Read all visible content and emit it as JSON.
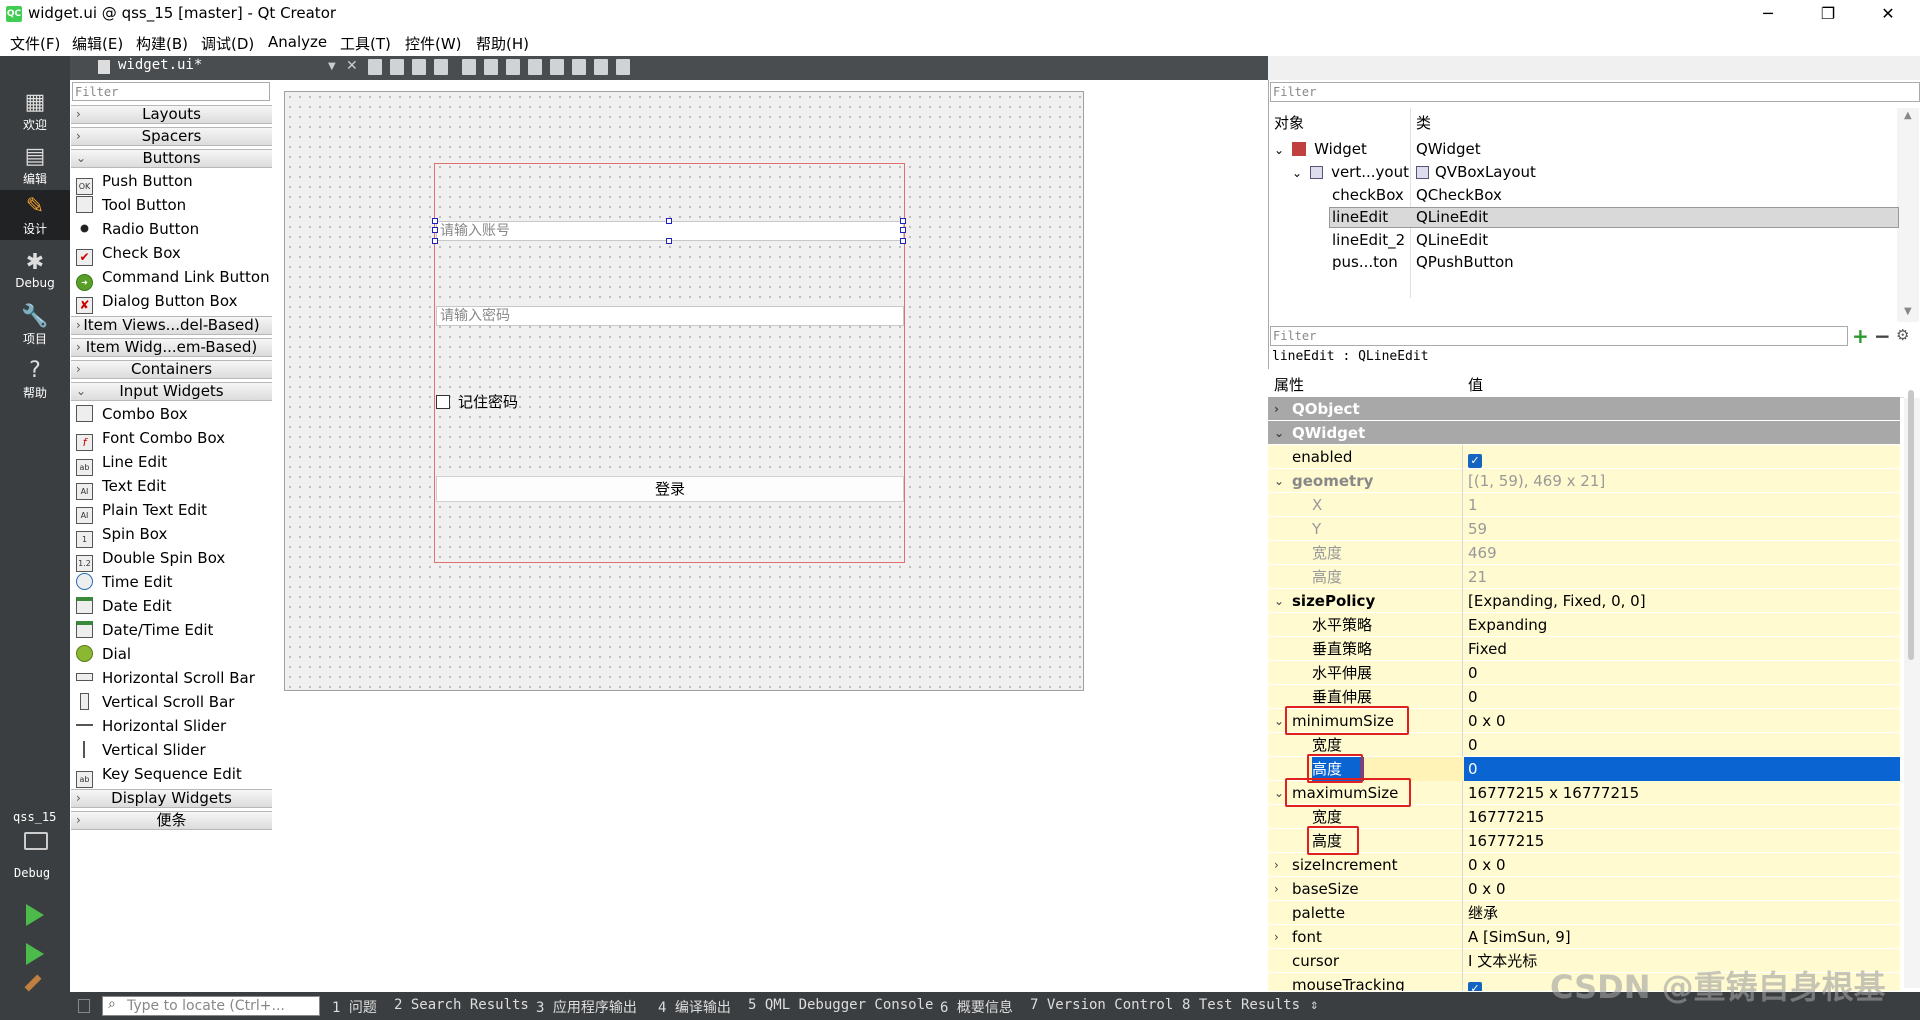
{
  "window": {
    "title": "widget.ui @ qss_15 [master] - Qt Creator",
    "app_icon_text": "QC",
    "minimize": "─",
    "restore": "❐",
    "close": "✕"
  },
  "menu": [
    "文件(F)",
    "编辑(E)",
    "构建(B)",
    "调试(D)",
    "Analyze",
    "工具(T)",
    "控件(W)",
    "帮助(H)"
  ],
  "modes": [
    {
      "label": "欢迎",
      "icon": "grid-icon",
      "glyph": "▦"
    },
    {
      "label": "编辑",
      "icon": "document-icon",
      "glyph": "▤"
    },
    {
      "label": "设计",
      "icon": "pencil-icon",
      "glyph": "✎"
    },
    {
      "label": "Debug",
      "icon": "bug-icon",
      "glyph": "✱"
    },
    {
      "label": "项目",
      "icon": "wrench-icon",
      "glyph": "🔧"
    },
    {
      "label": "帮助",
      "icon": "help-icon",
      "glyph": "?"
    }
  ],
  "kit": {
    "project": "qss_15",
    "config": "Debug"
  },
  "editor": {
    "file_tab": "widget.ui*",
    "close": "✕"
  },
  "widget_box": {
    "filter_placeholder": "Filter",
    "categories": {
      "layouts": "Layouts",
      "spacers": "Spacers",
      "buttons": "Buttons",
      "item_views": "Item Views...del-Based)",
      "item_widgets": "Item Widg...em-Based)",
      "containers": "Containers",
      "input_widgets": "Input Widgets",
      "display_widgets": "Display Widgets",
      "scratchpad": "便条"
    },
    "buttons": [
      "Push Button",
      "Tool Button",
      "Radio Button",
      "Check Box",
      "Command Link Button",
      "Dialog Button Box"
    ],
    "inputs": [
      "Combo Box",
      "Font Combo Box",
      "Line Edit",
      "Text Edit",
      "Plain Text Edit",
      "Spin Box",
      "Double Spin Box",
      "Time Edit",
      "Date Edit",
      "Date/Time Edit",
      "Dial",
      "Horizontal Scroll Bar",
      "Vertical Scroll Bar",
      "Horizontal Slider",
      "Vertical Slider",
      "Key Sequence Edit"
    ]
  },
  "form": {
    "account_placeholder": "请输入账号",
    "password_placeholder": "请输入密码",
    "remember_label": "记住密码",
    "login_label": "登录"
  },
  "object_inspector": {
    "filter_placeholder": "Filter",
    "col_object": "对象",
    "col_class": "类",
    "rows": [
      {
        "name": "Widget",
        "cls": "QWidget"
      },
      {
        "name": "vert...yout",
        "cls": "QVBoxLayout"
      },
      {
        "name": "checkBox",
        "cls": "QCheckBox"
      },
      {
        "name": "lineEdit",
        "cls": "QLineEdit"
      },
      {
        "name": "lineEdit_2",
        "cls": "QLineEdit"
      },
      {
        "name": "pus...ton",
        "cls": "QPushButton"
      }
    ]
  },
  "property_editor": {
    "filter_placeholder": "Filter",
    "title": "lineEdit : QLineEdit",
    "col_property": "属性",
    "col_value": "值",
    "rows": [
      {
        "name": "QObject",
        "value": ""
      },
      {
        "name": "QWidget",
        "value": ""
      },
      {
        "name": "enabled",
        "value": "✓"
      },
      {
        "name": "geometry",
        "value": "[(1, 59), 469 x 21]"
      },
      {
        "name": "X",
        "value": "1"
      },
      {
        "name": "Y",
        "value": "59"
      },
      {
        "name": "宽度",
        "value": "469"
      },
      {
        "name": "高度",
        "value": "21"
      },
      {
        "name": "sizePolicy",
        "value": "[Expanding, Fixed, 0, 0]"
      },
      {
        "name": "水平策略",
        "value": "Expanding"
      },
      {
        "name": "垂直策略",
        "value": "Fixed"
      },
      {
        "name": "水平伸展",
        "value": "0"
      },
      {
        "name": "垂直伸展",
        "value": "0"
      },
      {
        "name": "minimumSize",
        "value": "0 x 0"
      },
      {
        "name": "宽度",
        "value": "0"
      },
      {
        "name": "高度",
        "value": "0"
      },
      {
        "name": "maximumSize",
        "value": "16777215 x 16777215"
      },
      {
        "name": "宽度",
        "value": "16777215"
      },
      {
        "name": "高度",
        "value": "16777215"
      },
      {
        "name": "sizeIncrement",
        "value": "0 x 0"
      },
      {
        "name": "baseSize",
        "value": "0 x 0"
      },
      {
        "name": "palette",
        "value": "继承"
      },
      {
        "name": "font",
        "value": "A  [SimSun, 9]"
      },
      {
        "name": "cursor",
        "value": "I  文本光标"
      },
      {
        "name": "mouseTracking",
        "value": "✓"
      }
    ]
  },
  "statusbar": {
    "locator_placeholder": "Type to locate (Ctrl+...",
    "tabs": [
      "1 问题",
      "2 Search Results",
      "3 应用程序输出",
      "4 编译输出",
      "5 QML Debugger Console",
      "6 概要信息",
      "7 Version Control",
      "8 Test Results"
    ]
  },
  "watermark": "CSDN @重铸自身根基"
}
